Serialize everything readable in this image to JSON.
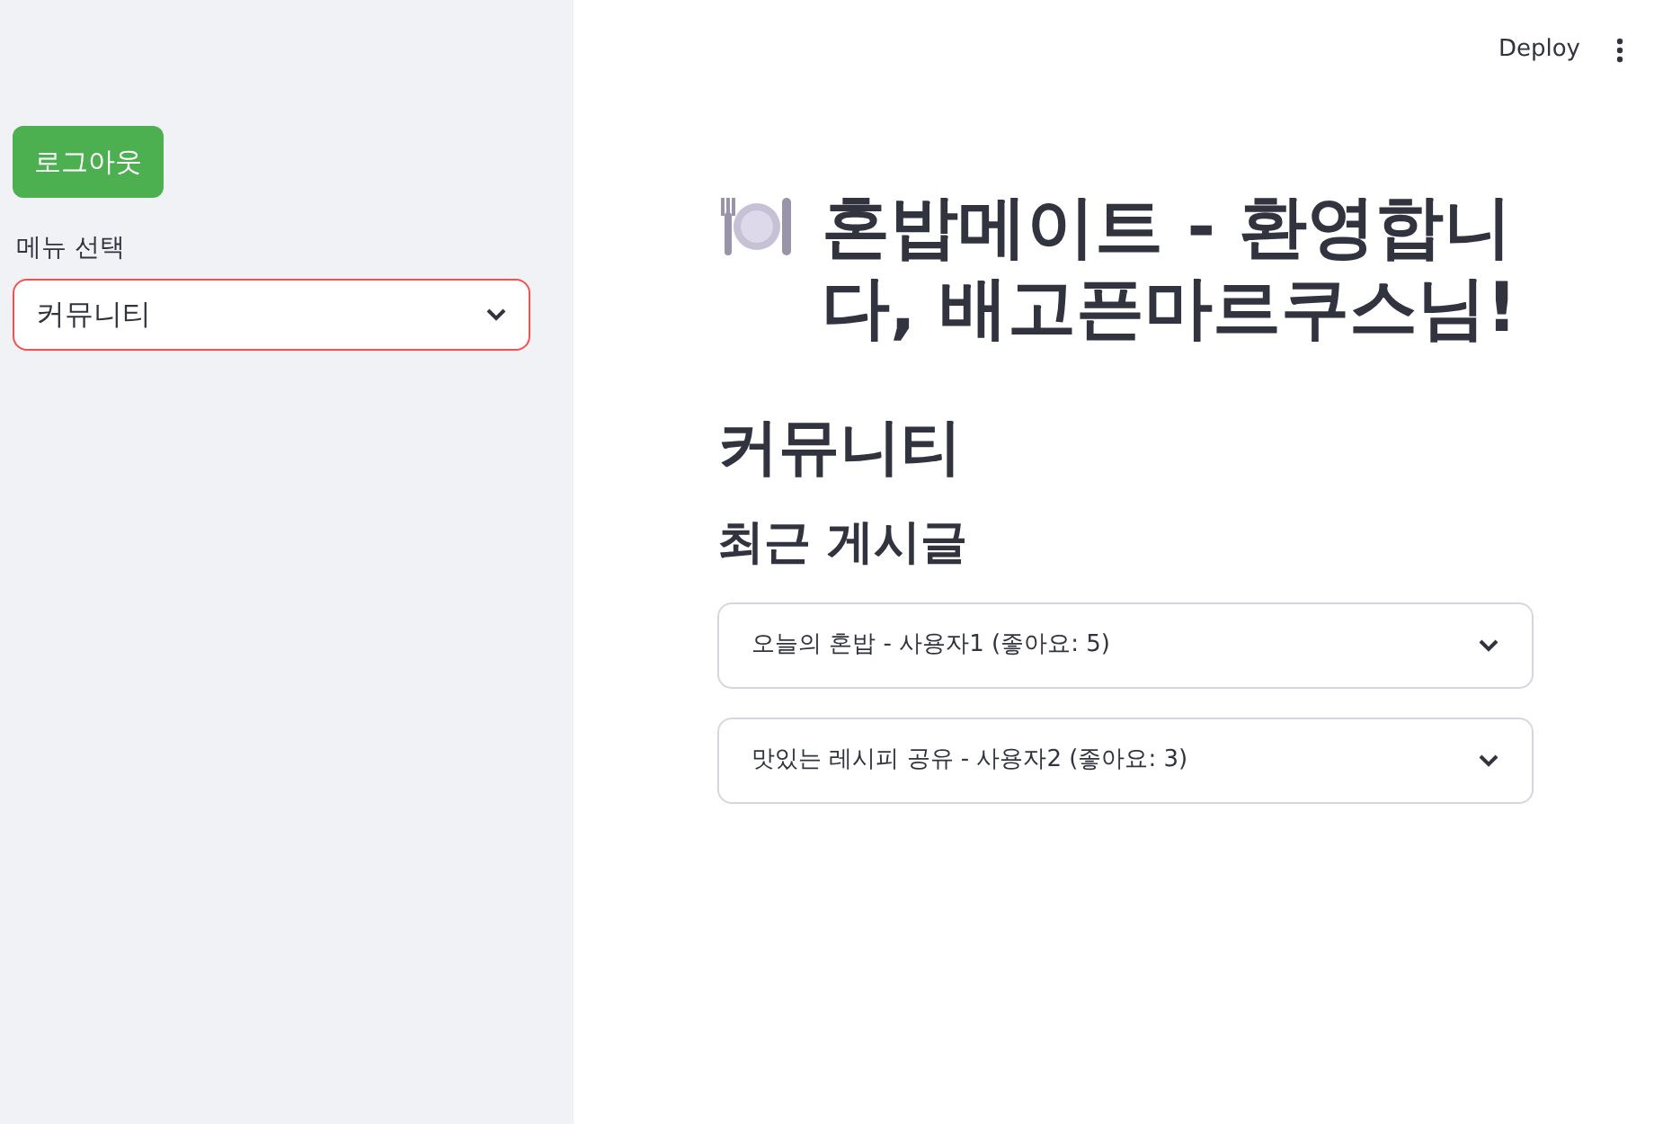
{
  "toolbar": {
    "deploy": "Deploy"
  },
  "sidebar": {
    "logout_button": "로그아웃",
    "menu_label": "메뉴 선택",
    "menu_select": {
      "value": "커뮤니티",
      "focused": true
    }
  },
  "main": {
    "title": "혼밥메이트 - 환영합니다, 배고픈마르쿠스님!",
    "section_title": "커뮤니티",
    "subsection_title": "최근 게시글",
    "posts": [
      {
        "label": "오늘의 혼밥 - 사용자1 (좋아요: 5)",
        "expanded": false
      },
      {
        "label": "맛있는 레시피 공유 - 사용자2 (좋아요: 3)",
        "expanded": false
      }
    ]
  }
}
